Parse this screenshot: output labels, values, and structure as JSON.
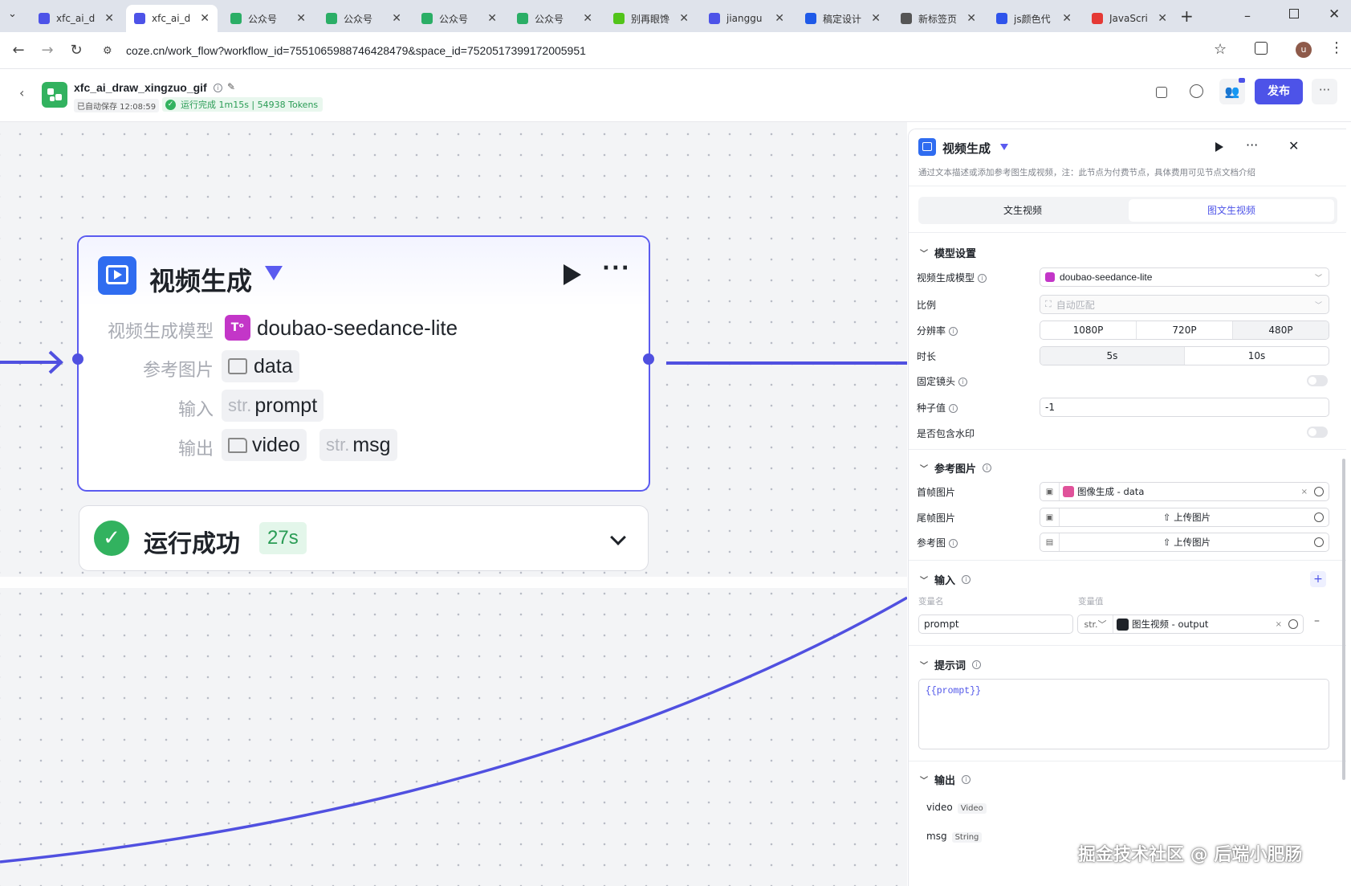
{
  "browser": {
    "tabs": [
      {
        "label": "xfc_ai_d",
        "active": false,
        "favicon_color": "#4d53e8"
      },
      {
        "label": "xfc_ai_d",
        "active": true,
        "favicon_color": "#4d53e8"
      },
      {
        "label": "公众号",
        "active": false,
        "favicon_color": "#2bae66"
      },
      {
        "label": "公众号",
        "active": false,
        "favicon_color": "#2bae66"
      },
      {
        "label": "公众号",
        "active": false,
        "favicon_color": "#2bae66"
      },
      {
        "label": "公众号",
        "active": false,
        "favicon_color": "#2bae66"
      },
      {
        "label": "别再眼馋",
        "active": false,
        "favicon_color": "#52c41a"
      },
      {
        "label": "jianggu",
        "active": false,
        "favicon_color": "#4d53e8"
      },
      {
        "label": "稿定设计",
        "active": false,
        "favicon_color": "#1f5ae8"
      },
      {
        "label": "新标签页",
        "active": false,
        "favicon_color": "#555555"
      },
      {
        "label": "js颜色代",
        "active": false,
        "favicon_color": "#2f54eb"
      },
      {
        "label": "JavaScri",
        "active": false,
        "favicon_color": "#e53935"
      }
    ],
    "url": "coze.cn/work_flow?workflow_id=7551065988746428479&space_id=7520517399172005951",
    "profile_initial": "u"
  },
  "app": {
    "workflow_name": "xfc_ai_draw_xingzuo_gif",
    "autosave": "已自动保存 12:08:59",
    "run_status": "运行完成 1m15s | 54938 Tokens",
    "publish_label": "发布"
  },
  "node": {
    "title": "视频生成",
    "rows": [
      {
        "label": "视频生成模型",
        "value": "doubao-seedance-lite"
      },
      {
        "label": "参考图片",
        "value": "data"
      },
      {
        "label": "输入",
        "prefix": "str.",
        "value": "prompt"
      },
      {
        "label": "输出",
        "value": "video",
        "prefix2": "str.",
        "value2": "msg"
      }
    ],
    "run_result": "运行成功",
    "run_time": "27s"
  },
  "panel": {
    "title": "视频生成",
    "description": "通过文本描述或添加参考图生成视频，注：此节点为付费节点，具体费用可见节点文档介绍",
    "tabs": [
      "文生视频",
      "图文生视频"
    ],
    "active_tab": 1,
    "model_section": "模型设置",
    "model_label": "视频生成模型",
    "model_value": "doubao-seedance-lite",
    "ratio_label": "比例",
    "ratio_value": "自动匹配",
    "resolution_label": "分辨率",
    "resolutions": [
      "1080P",
      "720P",
      "480P"
    ],
    "resolution_selected": 2,
    "duration_label": "时长",
    "durations": [
      "5s",
      "10s"
    ],
    "duration_selected": 0,
    "fixed_camera_label": "固定镜头",
    "seed_label": "种子值",
    "seed_value": "-1",
    "watermark_label": "是否包含水印",
    "ref_section": "参考图片",
    "first_frame_label": "首帧图片",
    "first_frame_value": "图像生成 - data",
    "last_frame_label": "尾帧图片",
    "upload_label": "上传图片",
    "ref_image_label": "参考图",
    "input_section": "输入",
    "var_name_header": "变量名",
    "var_value_header": "变量值",
    "input_var_name": "prompt",
    "input_var_type": "str.",
    "input_var_value": "图生视频 - output",
    "prompt_section": "提示词",
    "prompt_value": "{{prompt}}",
    "output_section": "输出",
    "outputs": [
      {
        "name": "video",
        "type": "Video"
      },
      {
        "name": "msg",
        "type": "String"
      }
    ]
  },
  "watermark_text": "掘金技术社区 @ 后端小肥肠",
  "colors": {
    "accent": "#4d53e8",
    "edge": "#5050e0",
    "success": "#32b25f"
  }
}
